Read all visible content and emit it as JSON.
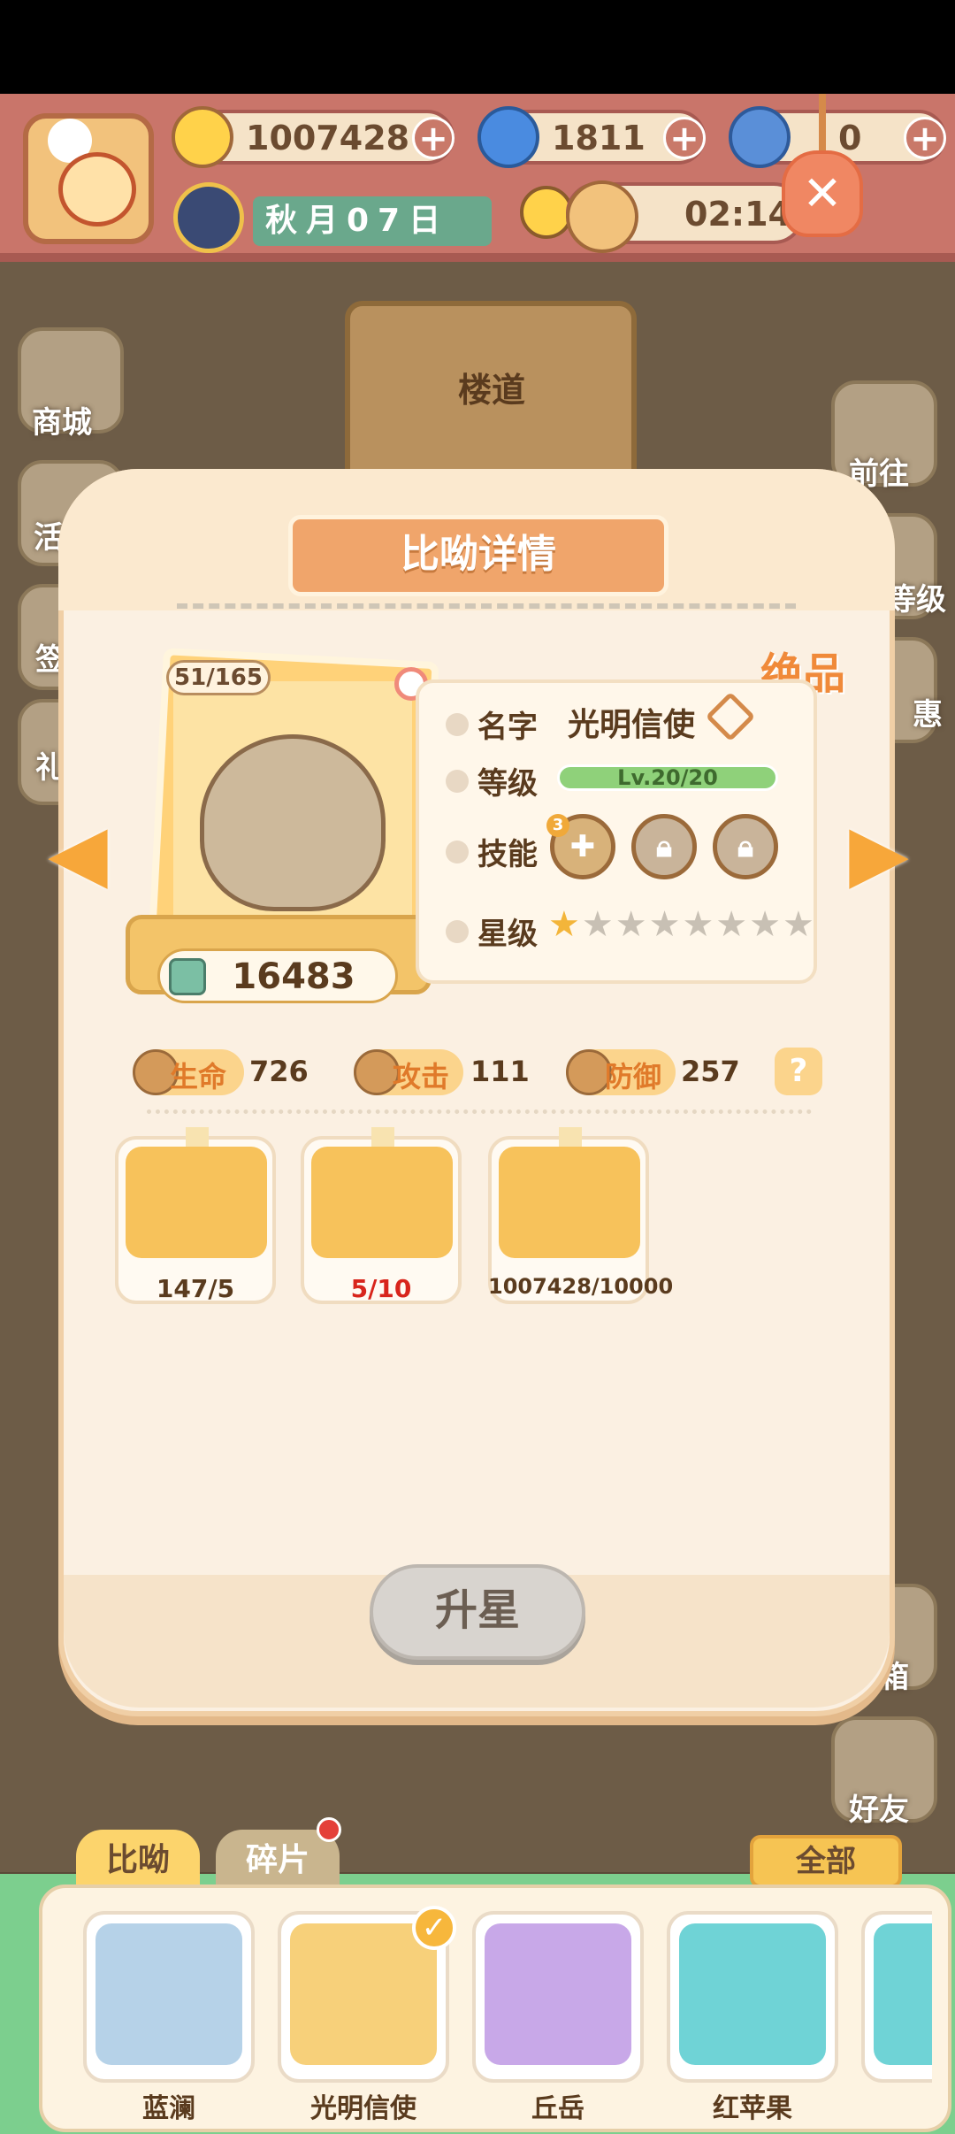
{
  "resources": {
    "banana": "1007428",
    "flame": "1811",
    "blue_banana": "0"
  },
  "calendar": {
    "date_text": "秋月07日"
  },
  "timer": "02:14",
  "background": {
    "hall_label": "楼道"
  },
  "side_menu": {
    "left": [
      "商城",
      "活",
      "签",
      "礼"
    ],
    "right": [
      "前往",
      "等级",
      "惠",
      "邮箱",
      "好友"
    ]
  },
  "panel": {
    "title": "比呦详情",
    "quality": "绝品",
    "card": {
      "counter": "51/165",
      "power": "16483"
    },
    "info": {
      "name_label": "名字",
      "name_value": "光明信使",
      "level_label": "等级",
      "level_value": "Lv.20/20",
      "skills_label": "技能",
      "skill_badge": "3",
      "stars_label": "星级",
      "stars_total": 8,
      "stars_on": 1
    },
    "stats": [
      {
        "label": "生命",
        "value": "726"
      },
      {
        "label": "攻击",
        "value": "111"
      },
      {
        "label": "防御",
        "value": "257"
      }
    ],
    "help": "?",
    "materials": [
      {
        "value": "147/5"
      },
      {
        "value": "5/10"
      },
      {
        "value": "1007428/10000"
      }
    ],
    "upgrade_button": "升星"
  },
  "bottom": {
    "tab_active": "比呦",
    "tab_inactive": "碎片",
    "filter": "全部",
    "characters": [
      "蓝澜",
      "光明信使",
      "丘岳",
      "红苹果"
    ],
    "colors": {
      "char1": "#c9a07a",
      "char2": "#f7d07a",
      "char3": "#c8a8e8",
      "char4": "#6fd3d6"
    }
  }
}
